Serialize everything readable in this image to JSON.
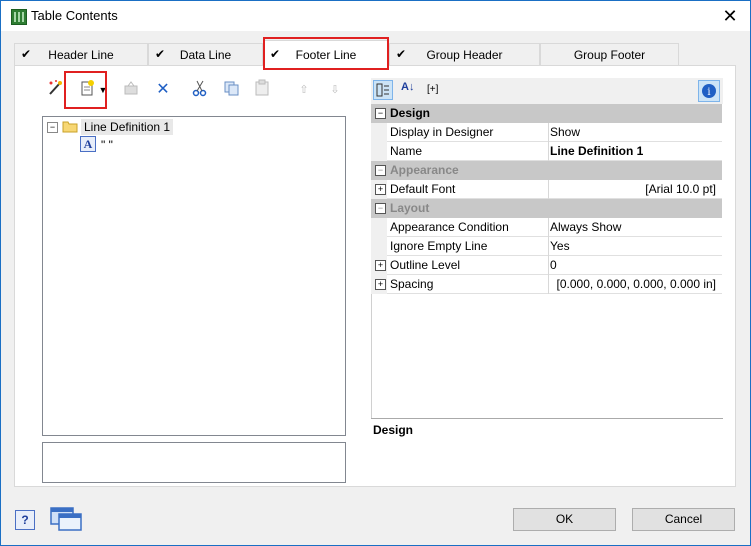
{
  "window": {
    "title": "Table Contents"
  },
  "tabs": [
    {
      "label": "Header Line",
      "checked": true
    },
    {
      "label": "Data Line",
      "checked": true
    },
    {
      "label": "Footer Line",
      "checked": true,
      "active": true
    },
    {
      "label": "Group Header",
      "checked": true
    },
    {
      "label": "Group Footer",
      "checked": false
    }
  ],
  "check_glyph": "✔",
  "tree": {
    "root_label": "Line Definition  1",
    "child_label": "\" \""
  },
  "property_grid": {
    "categories": [
      {
        "label": "Design",
        "rows": [
          {
            "name": "Display in Designer",
            "value": "Show"
          },
          {
            "name": "Name",
            "value": "Line Definition  1"
          }
        ]
      },
      {
        "label": "Appearance",
        "rows": [
          {
            "name": "Default Font",
            "value": "[Arial 10.0 pt]"
          }
        ]
      },
      {
        "label": "Layout",
        "rows": [
          {
            "name": "Appearance Condition",
            "value": "Always Show"
          },
          {
            "name": "Ignore Empty Line",
            "value": "Yes"
          },
          {
            "name": "Outline Level",
            "value": "0"
          },
          {
            "name": "Spacing",
            "value": "[0.000, 0.000, 0.000, 0.000 in]"
          }
        ]
      }
    ],
    "description_title": "Design",
    "toolbar_label": "[+]"
  },
  "buttons": {
    "ok": "OK",
    "cancel": "Cancel"
  }
}
